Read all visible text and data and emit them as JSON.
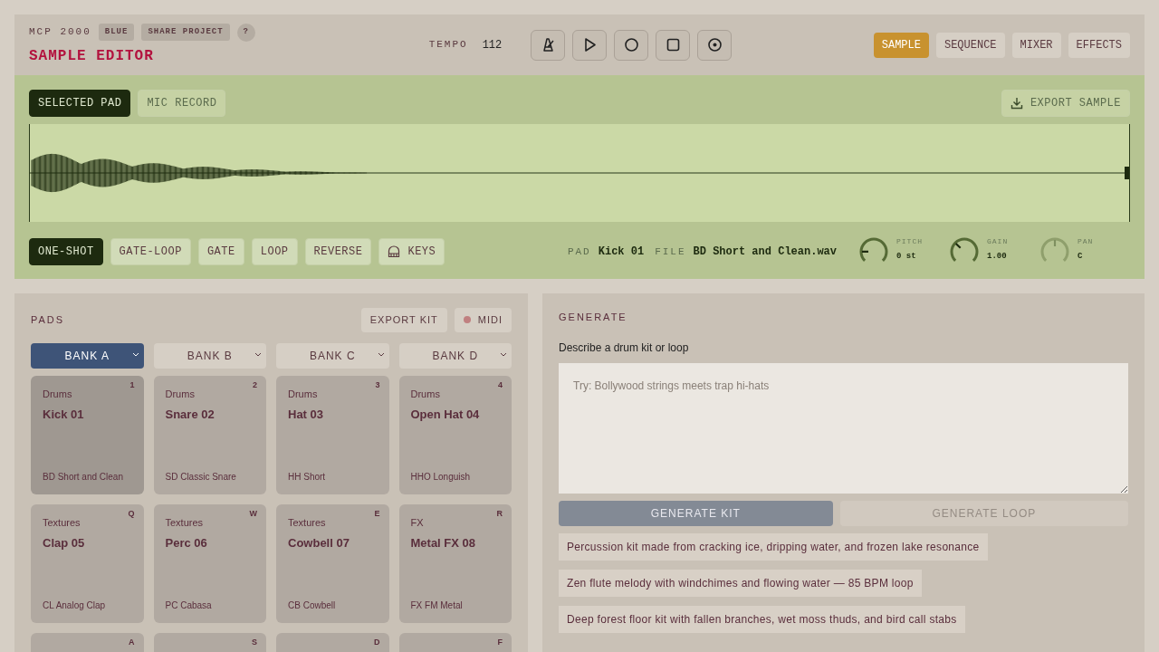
{
  "header": {
    "app_name": "MCP 2000",
    "badges": [
      "BLUE",
      "SHARE PROJECT",
      "?"
    ],
    "title": "SAMPLE EDITOR",
    "tempo_label": "TEMPO",
    "tempo": "112"
  },
  "transport": [
    {
      "kind": "metronome"
    },
    {
      "kind": "play"
    },
    {
      "kind": "record"
    },
    {
      "kind": "stop"
    },
    {
      "kind": "target"
    }
  ],
  "tabs": [
    {
      "label": "SAMPLE",
      "selected": true
    },
    {
      "label": "SEQUENCE",
      "selected": false
    },
    {
      "label": "MIXER",
      "selected": false
    },
    {
      "label": "EFFECTS",
      "selected": false
    }
  ],
  "sample": {
    "sources": [
      {
        "label": "SELECTED PAD",
        "selected": true
      },
      {
        "label": "MIC RECORD",
        "selected": false
      }
    ],
    "export": "EXPORT SAMPLE",
    "modes": [
      {
        "label": "ONE-SHOT",
        "selected": true
      },
      {
        "label": "GATE-LOOP",
        "selected": false
      },
      {
        "label": "GATE",
        "selected": false
      },
      {
        "label": "LOOP",
        "selected": false
      },
      {
        "label": "REVERSE",
        "selected": false
      },
      {
        "label": "KEYS",
        "selected": false,
        "kind": "keys"
      }
    ],
    "pad_label": "PAD",
    "pad": "Kick 01",
    "file_label": "FILE",
    "file": "BD Short and Clean.wav",
    "knobs": [
      {
        "label": "PITCH",
        "reading": "0 st",
        "level": 0.17,
        "disabled": false
      },
      {
        "label": "GAIN",
        "reading": "1.00",
        "level": 0.33,
        "disabled": false
      },
      {
        "label": "PAN",
        "reading": "C",
        "level": 0.5,
        "disabled": true
      }
    ]
  },
  "pads_panel": {
    "title": "PADS",
    "export": "EXPORT KIT",
    "midi": "MIDI",
    "midi_on": false,
    "banks": [
      {
        "label": "BANK A",
        "selected": true
      },
      {
        "label": "BANK B",
        "selected": false
      },
      {
        "label": "BANK C",
        "selected": false
      },
      {
        "label": "BANK D",
        "selected": false
      }
    ],
    "pads": [
      {
        "key": "1",
        "category": "Drums",
        "name": "Kick 01",
        "file": "BD Short and Clean",
        "selected": true
      },
      {
        "key": "2",
        "category": "Drums",
        "name": "Snare 02",
        "file": "SD Classic Snare",
        "selected": false
      },
      {
        "key": "3",
        "category": "Drums",
        "name": "Hat 03",
        "file": "HH Short",
        "selected": false
      },
      {
        "key": "4",
        "category": "Drums",
        "name": "Open Hat 04",
        "file": "HHO Longuish",
        "selected": false
      },
      {
        "key": "Q",
        "category": "Textures",
        "name": "Clap 05",
        "file": "CL Analog Clap",
        "selected": false
      },
      {
        "key": "W",
        "category": "Textures",
        "name": "Perc 06",
        "file": "PC Cabasa",
        "selected": false
      },
      {
        "key": "E",
        "category": "Textures",
        "name": "Cowbell 07",
        "file": "CB Cowbell",
        "selected": false
      },
      {
        "key": "R",
        "category": "FX",
        "name": "Metal FX 08",
        "file": "FX FM Metal",
        "selected": false
      },
      {
        "key": "A",
        "selected": false
      },
      {
        "key": "S",
        "selected": false
      },
      {
        "key": "D",
        "selected": false
      },
      {
        "key": "F",
        "selected": false
      }
    ]
  },
  "generate": {
    "title": "GENERATE",
    "prompt_label": "Describe a drum kit or loop",
    "placeholder": "Try: Bollywood strings meets trap hi-hats",
    "buttons": [
      {
        "label": "GENERATE KIT",
        "disabled": false
      },
      {
        "label": "GENERATE LOOP",
        "disabled": true
      }
    ],
    "suggestions": [
      "Percussion kit made from cracking ice, dripping water, and frozen lake resonance",
      "Zen flute melody with windchimes and flowing water — 85 BPM loop",
      "Deep forest floor kit with fallen branches, wet moss thuds, and bird call stabs"
    ]
  }
}
